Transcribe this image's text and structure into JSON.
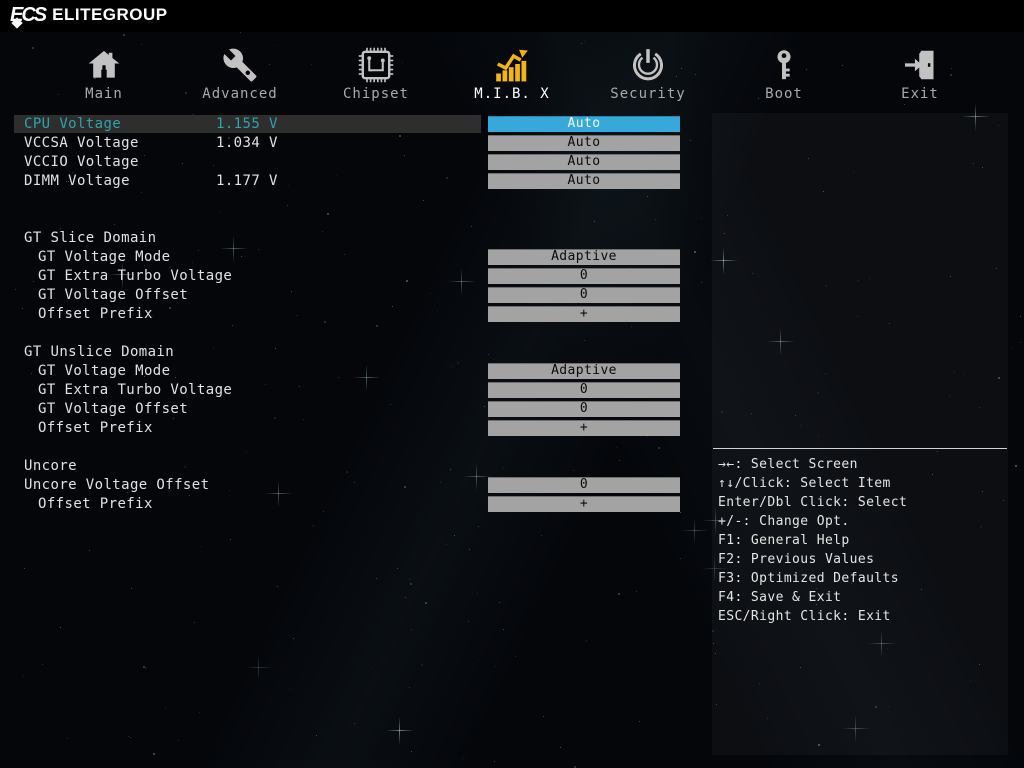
{
  "brand": {
    "logo_text": "ECS",
    "name": "ELITEGROUP"
  },
  "tabs": [
    {
      "label": "Main",
      "icon": "home-icon",
      "selected": false
    },
    {
      "label": "Advanced",
      "icon": "wrench-icon",
      "selected": false
    },
    {
      "label": "Chipset",
      "icon": "chip-icon",
      "selected": false
    },
    {
      "label": "M.I.B. X",
      "icon": "chart-icon",
      "selected": true
    },
    {
      "label": "Security",
      "icon": "security-icon",
      "selected": false
    },
    {
      "label": "Boot",
      "icon": "key-icon",
      "selected": false
    },
    {
      "label": "Exit",
      "icon": "exit-icon",
      "selected": false
    }
  ],
  "settings_rows": [
    {
      "type": "setting",
      "label": "CPU Voltage",
      "value": "1.155 V",
      "control": "Auto",
      "indent": 0,
      "highlighted": true,
      "control_selected": true
    },
    {
      "type": "setting",
      "label": "VCCSA Voltage",
      "value": "1.034 V",
      "control": "Auto",
      "indent": 0
    },
    {
      "type": "setting",
      "label": "VCCIO Voltage",
      "value": "",
      "control": "Auto",
      "indent": 0
    },
    {
      "type": "setting",
      "label": "DIMM Voltage",
      "value": "1.177 V",
      "control": "Auto",
      "indent": 0
    },
    {
      "type": "gap"
    },
    {
      "type": "gap"
    },
    {
      "type": "header",
      "label": "GT Slice Domain"
    },
    {
      "type": "setting",
      "label": "GT Voltage Mode",
      "control": "Adaptive",
      "indent": 1
    },
    {
      "type": "setting",
      "label": "GT Extra Turbo Voltage",
      "control": "0",
      "indent": 1
    },
    {
      "type": "setting",
      "label": "GT Voltage Offset",
      "control": "0",
      "indent": 1
    },
    {
      "type": "setting",
      "label": "Offset Prefix",
      "control": "+",
      "indent": 1
    },
    {
      "type": "gap"
    },
    {
      "type": "header",
      "label": "GT Unslice Domain"
    },
    {
      "type": "setting",
      "label": "GT Voltage Mode",
      "control": "Adaptive",
      "indent": 1
    },
    {
      "type": "setting",
      "label": "GT Extra Turbo Voltage",
      "control": "0",
      "indent": 1
    },
    {
      "type": "setting",
      "label": "GT Voltage Offset",
      "control": "0",
      "indent": 1
    },
    {
      "type": "setting",
      "label": "Offset Prefix",
      "control": "+",
      "indent": 1
    },
    {
      "type": "gap"
    },
    {
      "type": "header",
      "label": "Uncore"
    },
    {
      "type": "setting",
      "label": "Uncore Voltage Offset",
      "control": "0",
      "indent": 0
    },
    {
      "type": "setting",
      "label": "Offset Prefix",
      "control": "+",
      "indent": 1
    }
  ],
  "help_legend": {
    "lines": [
      "→←: Select Screen",
      "↑↓/Click: Select Item",
      "Enter/Dbl Click: Select",
      "+/-: Change Opt.",
      "F1: General Help",
      "F2: Previous Values",
      "F3: Optimized Defaults",
      "F4: Save & Exit",
      "ESC/Right Click: Exit"
    ]
  },
  "colors": {
    "accent_yellow": "#f2b512",
    "control_gray": "#a3a3a3",
    "control_selected_blue": "#36a9da",
    "highlight_teal": "#2fa3ac",
    "highlight_row_bg": "#2e2e2e"
  }
}
